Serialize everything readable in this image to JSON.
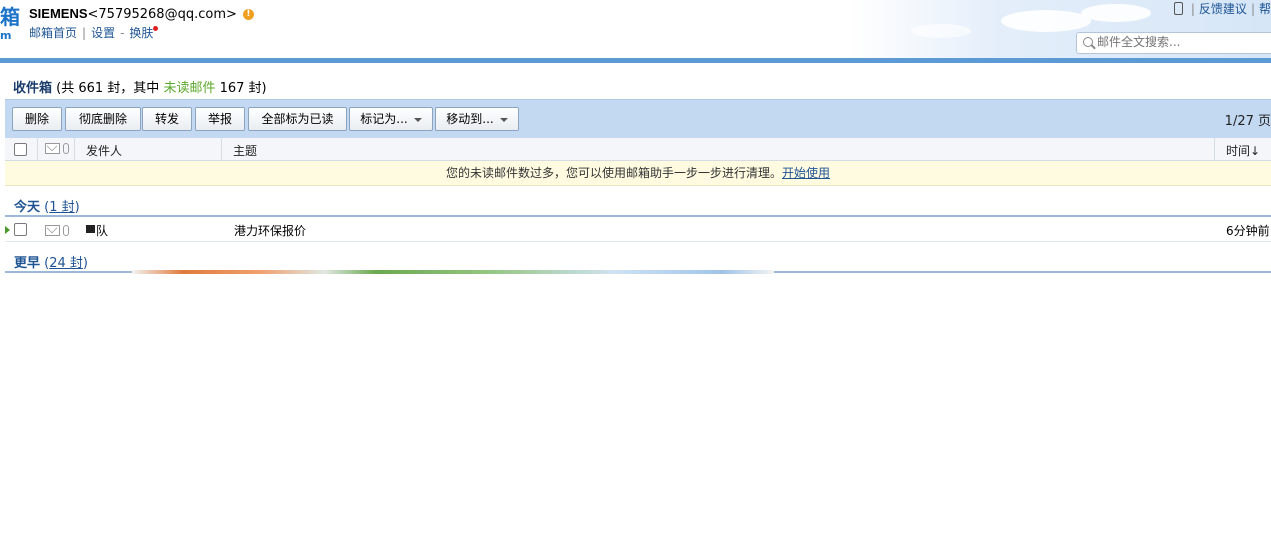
{
  "header": {
    "logo_char": "箱",
    "logo_sub": "m",
    "account_name": "SIEMENS",
    "account_email": "<75795268@qq.com>",
    "links": [
      "邮箱首页",
      "设置",
      "换肤"
    ],
    "right_links": [
      "反馈建议",
      "帮"
    ],
    "search_placeholder": "邮件全文搜索..."
  },
  "folder": {
    "name": "收件箱",
    "summary_prefix": "(共 661 封，其中",
    "unread_label": "未读邮件",
    "summary_suffix": "167 封)"
  },
  "toolbar": {
    "delete": "删除",
    "delete_permanently": "彻底删除",
    "forward": "转发",
    "report": "举报",
    "mark_all_read": "全部标为已读",
    "mark_as": "标记为...",
    "move_to": "移动到...",
    "pager": "1/27 页"
  },
  "columns": {
    "sender": "发件人",
    "subject": "主题",
    "time": "时间↓"
  },
  "notice": {
    "text": "您的未读邮件数过多，您可以使用邮箱助手一步一步进行清理。",
    "link": "开始使用"
  },
  "groups": {
    "today": {
      "name": "今天",
      "count_open": "(",
      "count": "1 封",
      "count_close": ")"
    },
    "earlier": {
      "name": "更早",
      "count_open": "(",
      "count": "24 封",
      "count_close": ")"
    }
  },
  "emails": [
    {
      "sender": "队",
      "subject": "港力环保报价",
      "time": "6分钟前"
    }
  ],
  "colors": {
    "accent_blue": "#5c9ad6",
    "toolbar_bg": "#c3d9f2",
    "unread_green": "#5ba82b",
    "notice_bg": "#fffbe1"
  }
}
